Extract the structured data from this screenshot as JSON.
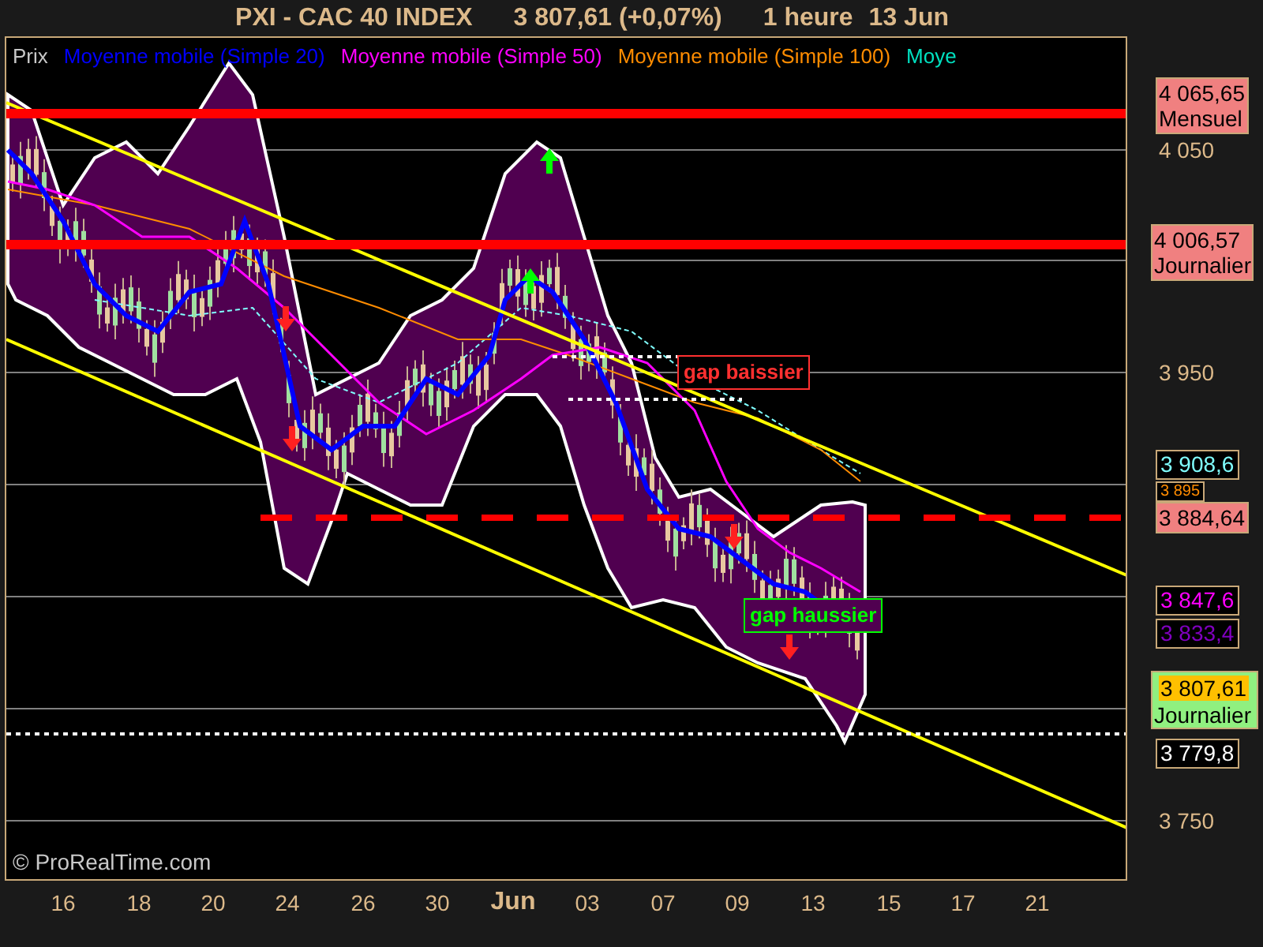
{
  "title": {
    "symbol": "PXI - CAC 40 INDEX",
    "price": "3 807,61 (+0,07%)",
    "timeframe": "1 heure",
    "date": "13 Jun"
  },
  "legend": [
    {
      "label": "Prix",
      "color": "#c8c8c8"
    },
    {
      "label": "Moyenne mobile (Simple 20)",
      "color": "#0000ff"
    },
    {
      "label": "Moyenne mobile (Simple 50)",
      "color": "#ff00ff"
    },
    {
      "label": "Moyenne mobile (Simple 100)",
      "color": "#ff8c00"
    },
    {
      "label": "Moye",
      "color": "#00e0c0"
    }
  ],
  "annotations": [
    {
      "label": "gap baissier",
      "kind": "bearish"
    },
    {
      "label": "gap haussier",
      "kind": "bullish"
    }
  ],
  "copyright": "© ProRealTime.com",
  "y_axis_labels": [
    "4 050",
    "3 950",
    "3 750"
  ],
  "price_tags": [
    {
      "value": "4 065,65",
      "note": "Mensuel",
      "kind": "alert"
    },
    {
      "value": "4 006,57",
      "note": "Journalier",
      "kind": "alert"
    },
    {
      "value": "3 908,6",
      "kind": "indicator",
      "color": "#80ffff"
    },
    {
      "value": "3 895",
      "kind": "indicator",
      "color": "#ff8c00"
    },
    {
      "value": "3 884,64",
      "kind": "alert"
    },
    {
      "value": "3 847,6",
      "kind": "indicator",
      "color": "#ff00ff"
    },
    {
      "value": "3 833,4",
      "kind": "indicator",
      "color": "#8000c0"
    },
    {
      "value": "3 807,61",
      "note": "Journalier",
      "kind": "price"
    },
    {
      "value": "3 779,8",
      "kind": "indicator",
      "color": "#ffffff"
    }
  ],
  "x_axis_labels": [
    {
      "label": "16",
      "bold": false
    },
    {
      "label": "18",
      "bold": false
    },
    {
      "label": "20",
      "bold": false
    },
    {
      "label": "24",
      "bold": false
    },
    {
      "label": "26",
      "bold": false
    },
    {
      "label": "30",
      "bold": false
    },
    {
      "label": "Jun",
      "bold": true
    },
    {
      "label": "03",
      "bold": false
    },
    {
      "label": "07",
      "bold": false
    },
    {
      "label": "09",
      "bold": false
    },
    {
      "label": "13",
      "bold": false
    },
    {
      "label": "15",
      "bold": false
    },
    {
      "label": "17",
      "bold": false
    },
    {
      "label": "21",
      "bold": false
    }
  ]
}
